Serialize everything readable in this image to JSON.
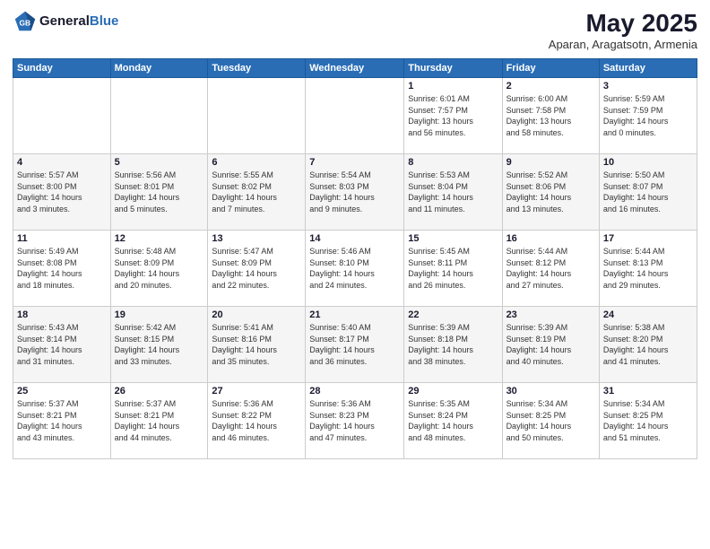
{
  "header": {
    "logo_line1": "General",
    "logo_line2": "Blue",
    "title": "May 2025",
    "subtitle": "Aparan, Aragatsotn, Armenia"
  },
  "weekdays": [
    "Sunday",
    "Monday",
    "Tuesday",
    "Wednesday",
    "Thursday",
    "Friday",
    "Saturday"
  ],
  "weeks": [
    [
      {
        "day": "",
        "info": ""
      },
      {
        "day": "",
        "info": ""
      },
      {
        "day": "",
        "info": ""
      },
      {
        "day": "",
        "info": ""
      },
      {
        "day": "1",
        "info": "Sunrise: 6:01 AM\nSunset: 7:57 PM\nDaylight: 13 hours\nand 56 minutes."
      },
      {
        "day": "2",
        "info": "Sunrise: 6:00 AM\nSunset: 7:58 PM\nDaylight: 13 hours\nand 58 minutes."
      },
      {
        "day": "3",
        "info": "Sunrise: 5:59 AM\nSunset: 7:59 PM\nDaylight: 14 hours\nand 0 minutes."
      }
    ],
    [
      {
        "day": "4",
        "info": "Sunrise: 5:57 AM\nSunset: 8:00 PM\nDaylight: 14 hours\nand 3 minutes."
      },
      {
        "day": "5",
        "info": "Sunrise: 5:56 AM\nSunset: 8:01 PM\nDaylight: 14 hours\nand 5 minutes."
      },
      {
        "day": "6",
        "info": "Sunrise: 5:55 AM\nSunset: 8:02 PM\nDaylight: 14 hours\nand 7 minutes."
      },
      {
        "day": "7",
        "info": "Sunrise: 5:54 AM\nSunset: 8:03 PM\nDaylight: 14 hours\nand 9 minutes."
      },
      {
        "day": "8",
        "info": "Sunrise: 5:53 AM\nSunset: 8:04 PM\nDaylight: 14 hours\nand 11 minutes."
      },
      {
        "day": "9",
        "info": "Sunrise: 5:52 AM\nSunset: 8:06 PM\nDaylight: 14 hours\nand 13 minutes."
      },
      {
        "day": "10",
        "info": "Sunrise: 5:50 AM\nSunset: 8:07 PM\nDaylight: 14 hours\nand 16 minutes."
      }
    ],
    [
      {
        "day": "11",
        "info": "Sunrise: 5:49 AM\nSunset: 8:08 PM\nDaylight: 14 hours\nand 18 minutes."
      },
      {
        "day": "12",
        "info": "Sunrise: 5:48 AM\nSunset: 8:09 PM\nDaylight: 14 hours\nand 20 minutes."
      },
      {
        "day": "13",
        "info": "Sunrise: 5:47 AM\nSunset: 8:09 PM\nDaylight: 14 hours\nand 22 minutes."
      },
      {
        "day": "14",
        "info": "Sunrise: 5:46 AM\nSunset: 8:10 PM\nDaylight: 14 hours\nand 24 minutes."
      },
      {
        "day": "15",
        "info": "Sunrise: 5:45 AM\nSunset: 8:11 PM\nDaylight: 14 hours\nand 26 minutes."
      },
      {
        "day": "16",
        "info": "Sunrise: 5:44 AM\nSunset: 8:12 PM\nDaylight: 14 hours\nand 27 minutes."
      },
      {
        "day": "17",
        "info": "Sunrise: 5:44 AM\nSunset: 8:13 PM\nDaylight: 14 hours\nand 29 minutes."
      }
    ],
    [
      {
        "day": "18",
        "info": "Sunrise: 5:43 AM\nSunset: 8:14 PM\nDaylight: 14 hours\nand 31 minutes."
      },
      {
        "day": "19",
        "info": "Sunrise: 5:42 AM\nSunset: 8:15 PM\nDaylight: 14 hours\nand 33 minutes."
      },
      {
        "day": "20",
        "info": "Sunrise: 5:41 AM\nSunset: 8:16 PM\nDaylight: 14 hours\nand 35 minutes."
      },
      {
        "day": "21",
        "info": "Sunrise: 5:40 AM\nSunset: 8:17 PM\nDaylight: 14 hours\nand 36 minutes."
      },
      {
        "day": "22",
        "info": "Sunrise: 5:39 AM\nSunset: 8:18 PM\nDaylight: 14 hours\nand 38 minutes."
      },
      {
        "day": "23",
        "info": "Sunrise: 5:39 AM\nSunset: 8:19 PM\nDaylight: 14 hours\nand 40 minutes."
      },
      {
        "day": "24",
        "info": "Sunrise: 5:38 AM\nSunset: 8:20 PM\nDaylight: 14 hours\nand 41 minutes."
      }
    ],
    [
      {
        "day": "25",
        "info": "Sunrise: 5:37 AM\nSunset: 8:21 PM\nDaylight: 14 hours\nand 43 minutes."
      },
      {
        "day": "26",
        "info": "Sunrise: 5:37 AM\nSunset: 8:21 PM\nDaylight: 14 hours\nand 44 minutes."
      },
      {
        "day": "27",
        "info": "Sunrise: 5:36 AM\nSunset: 8:22 PM\nDaylight: 14 hours\nand 46 minutes."
      },
      {
        "day": "28",
        "info": "Sunrise: 5:36 AM\nSunset: 8:23 PM\nDaylight: 14 hours\nand 47 minutes."
      },
      {
        "day": "29",
        "info": "Sunrise: 5:35 AM\nSunset: 8:24 PM\nDaylight: 14 hours\nand 48 minutes."
      },
      {
        "day": "30",
        "info": "Sunrise: 5:34 AM\nSunset: 8:25 PM\nDaylight: 14 hours\nand 50 minutes."
      },
      {
        "day": "31",
        "info": "Sunrise: 5:34 AM\nSunset: 8:25 PM\nDaylight: 14 hours\nand 51 minutes."
      }
    ]
  ]
}
